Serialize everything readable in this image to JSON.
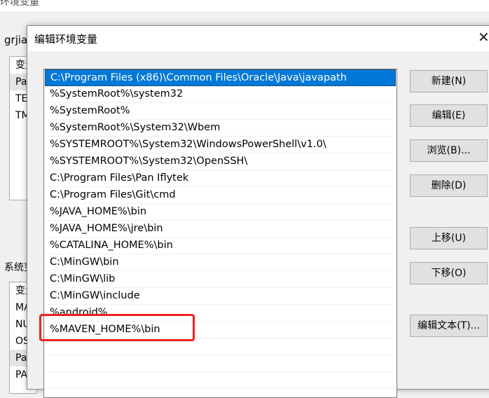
{
  "background_window": {
    "title": "环境变量",
    "user_label": "grjia",
    "user_vars": [
      "变量",
      "Path",
      "TEMP",
      "TMP"
    ],
    "system_label": "系统变量",
    "system_vars": [
      "变量",
      "MAVEN_HOME",
      "NUMBER_OF_PROCESSORS",
      "OS",
      "Path",
      "PATHEXT"
    ]
  },
  "dialog": {
    "title": "编辑环境变量",
    "close_icon": "close-icon",
    "paths": [
      "C:\\Program Files (x86)\\Common Files\\Oracle\\Java\\javapath",
      "%SystemRoot%\\system32",
      "%SystemRoot%",
      "%SystemRoot%\\System32\\Wbem",
      "%SYSTEMROOT%\\System32\\WindowsPowerShell\\v1.0\\",
      "%SYSTEMROOT%\\System32\\OpenSSH\\",
      "C:\\Program Files\\Pan Iflytek",
      "C:\\Program Files\\Git\\cmd",
      "%JAVA_HOME%\\bin",
      "%JAVA_HOME%\\jre\\bin",
      "%CATALINA_HOME%\\bin",
      "C:\\MinGW\\bin",
      "C:\\MinGW\\lib",
      "C:\\MinGW\\include",
      "%android%",
      "%MAVEN_HOME%\\bin"
    ],
    "selected_index": 0,
    "buttons": {
      "new": "新建(N)",
      "edit": "编辑(E)",
      "browse": "浏览(B)...",
      "delete": "删除(D)",
      "up": "上移(U)",
      "down": "下移(O)",
      "edit_text": "编辑文本(T)..."
    },
    "highlight_color": "#f02020"
  }
}
